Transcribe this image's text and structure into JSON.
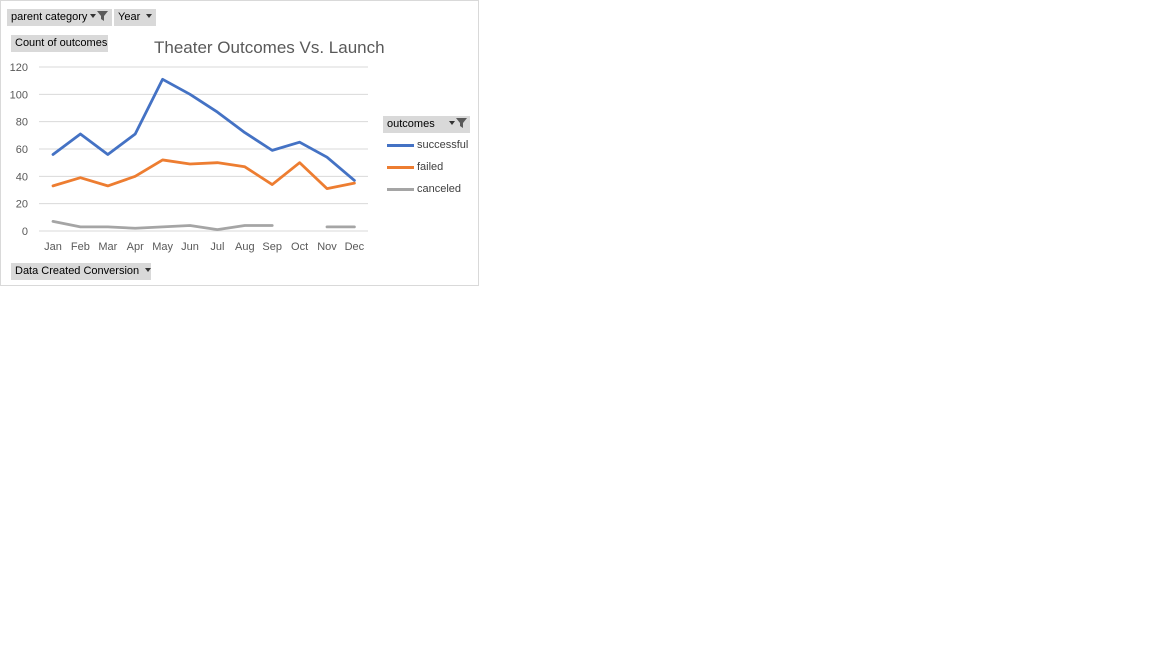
{
  "filters": {
    "parent_category": "parent category",
    "year": "Year"
  },
  "axis_field_button": "Count of outcomes",
  "legend_field_button": "outcomes",
  "category_field_button": "Data Created Conversion",
  "colors": {
    "successful": "#4472c4",
    "failed": "#ed7d31",
    "canceled": "#a5a5a5",
    "grid": "#d9d9d9",
    "button_bg": "#d9d9d9"
  },
  "chart_data": {
    "type": "line",
    "title": "Theater Outcomes Vs. Launch",
    "xlabel": "",
    "ylabel": "",
    "categories": [
      "Jan",
      "Feb",
      "Mar",
      "Apr",
      "May",
      "Jun",
      "Jul",
      "Aug",
      "Sep",
      "Oct",
      "Nov",
      "Dec"
    ],
    "y_ticks": [
      0,
      20,
      40,
      60,
      80,
      100,
      120
    ],
    "ylim": [
      0,
      120
    ],
    "grid": true,
    "legend_position": "right",
    "series": [
      {
        "name": "successful",
        "color": "#4472c4",
        "values": [
          56,
          71,
          56,
          71,
          111,
          100,
          87,
          72,
          59,
          65,
          54,
          37
        ]
      },
      {
        "name": "failed",
        "color": "#ed7d31",
        "values": [
          33,
          39,
          33,
          40,
          52,
          49,
          50,
          47,
          34,
          50,
          31,
          35
        ]
      },
      {
        "name": "canceled",
        "color": "#a5a5a5",
        "values": [
          7,
          3,
          3,
          2,
          3,
          4,
          1,
          4,
          4,
          null,
          3,
          3
        ]
      }
    ]
  }
}
